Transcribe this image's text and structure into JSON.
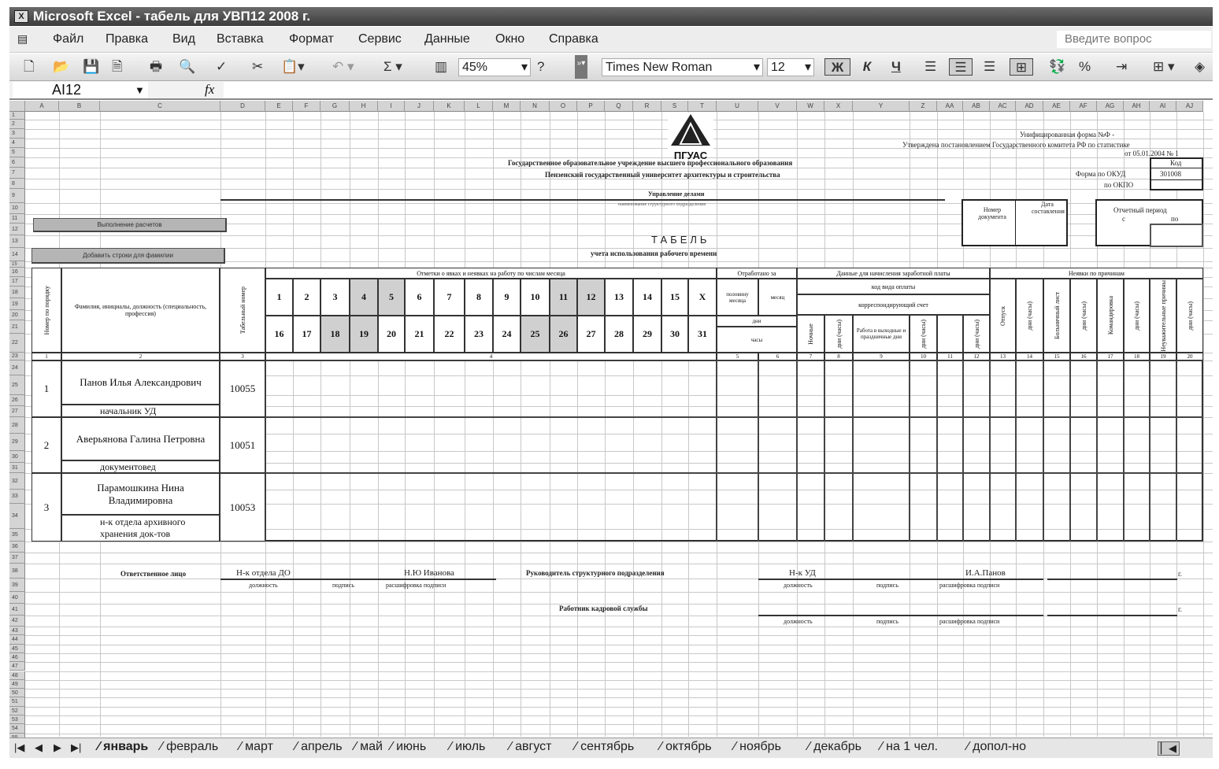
{
  "window": {
    "title": "Microsoft Excel - табель для УВП12 2008 г."
  },
  "menu": [
    "Файл",
    "Правка",
    "Вид",
    "Вставка",
    "Формат",
    "Сервис",
    "Данные",
    "Окно",
    "Справка"
  ],
  "help_placeholder": "Введите вопрос",
  "toolbar": {
    "zoom": "45%",
    "font": "Times New Roman",
    "size": "12",
    "bold": "Ж",
    "italic": "К",
    "underline": "Ч",
    "sum": "Σ",
    "percent": "%"
  },
  "formula_bar": {
    "name_box": "AI12",
    "fx": "fx",
    "value": ""
  },
  "columns": [
    "A",
    "B",
    "C",
    "D",
    "E",
    "F",
    "G",
    "H",
    "I",
    "J",
    "K",
    "L",
    "M",
    "N",
    "O",
    "P",
    "Q",
    "R",
    "S",
    "T",
    "U",
    "V",
    "W",
    "X",
    "Y",
    "Z",
    "AA",
    "AB",
    "AC",
    "AD",
    "AE",
    "AF",
    "AG",
    "AH",
    "AI",
    "AJ"
  ],
  "form": {
    "logo": "ПГУАС",
    "unified_form": "Унифицированная форма №Ф -",
    "approved": "Утверждена постановлением Государственного комитета РФ по статистике",
    "approved_date": "от 05.01.2004 № 1",
    "org_line1": "Государственное образовательное учреждение высшего профессионального образования",
    "org_line2": "Пензенский государственный университет архитектуры и строительства",
    "code_label": "Код",
    "okud_label": "Форма по ОКУД",
    "okud_value": "301008",
    "okpo_label": "по ОКПО",
    "department": "Управление делами",
    "department_caption": "наименование структурного подразделения",
    "doc_number": "Номер документа",
    "doc_date": "Дата составления",
    "period": "Отчетный период",
    "period_from": "с",
    "period_to": "по",
    "title": "ТАБЕЛЬ",
    "subtitle": "учета использования рабочего времени",
    "btn_calc": "Выполнение расчетов",
    "btn_add": "Добавить строки для фамилии"
  },
  "table": {
    "h_num": "Номер по порядку",
    "h_name": "Фамилия, инициалы, должность (специальность, профессия)",
    "h_tab": "Табельный номер",
    "h_marks": "Отметки о явках и неявках на работу по числам месяца",
    "days_row1": [
      "1",
      "2",
      "3",
      "4",
      "5",
      "6",
      "7",
      "8",
      "9",
      "10",
      "11",
      "12",
      "13",
      "14",
      "15",
      "X"
    ],
    "days_row2": [
      "16",
      "17",
      "18",
      "19",
      "20",
      "21",
      "22",
      "23",
      "24",
      "25",
      "26",
      "27",
      "28",
      "29",
      "30",
      "31"
    ],
    "weekends": [
      "4",
      "5",
      "11",
      "12",
      "18",
      "19",
      "25",
      "26"
    ],
    "h_worked": "Отработано за",
    "h_half": "половину месяца",
    "h_month": "месяц",
    "h_days": "дни",
    "h_hours": "часы",
    "h_pay": "Данные для начисления заработной платы",
    "h_paycode": "код вида оплаты",
    "h_account": "корреспондирующий счет",
    "h_night": "Ночные",
    "h_dh": "дни (часы)",
    "h_weekend": "Работа в выходные и праздничные дни",
    "h_absence": "Неявки по причинам",
    "h_vacation": "Отпуск",
    "h_sick": "Больничный лист",
    "h_trip": "Командировка",
    "h_unexcused": "Неуважительные причины",
    "col_numbers": [
      "1",
      "2",
      "3",
      "4",
      "5",
      "6",
      "7",
      "8",
      "9",
      "10",
      "11",
      "12",
      "13",
      "14",
      "15",
      "16",
      "17",
      "18",
      "19",
      "20"
    ],
    "rows": [
      {
        "num": "1",
        "name": "Панов Илья Александрович",
        "position": "начальник УД",
        "tab_no": "10055"
      },
      {
        "num": "2",
        "name": "Аверьянова Галина Петровна",
        "position": "документовед",
        "tab_no": "10051"
      },
      {
        "num": "3",
        "name": "Парамошкина Нина Владимировна",
        "position": "н-к отдела архивного хранения док-тов",
        "tab_no": "10053"
      }
    ]
  },
  "signatures": {
    "responsible": "Ответственное лицо",
    "resp_position": "Н-к отдела ДО",
    "resp_name": "Н.Ю Иванова",
    "head": "Руководитель структурного подразделения",
    "head_position": "Н-к УД",
    "head_name": "И.А.Панов",
    "hr": "Работник кадровой службы",
    "cap_position": "должность",
    "cap_sign": "подпись",
    "cap_decode": "расшифровка подписи",
    "year_suffix": "г."
  },
  "sheet_tabs": [
    "январь",
    "февраль",
    "март",
    "апрель",
    "май",
    "июнь",
    "июль",
    "август",
    "сентябрь",
    "октябрь",
    "ноябрь",
    "декабрь",
    "на 1 чел.",
    "допол-но"
  ],
  "active_tab": "январь"
}
